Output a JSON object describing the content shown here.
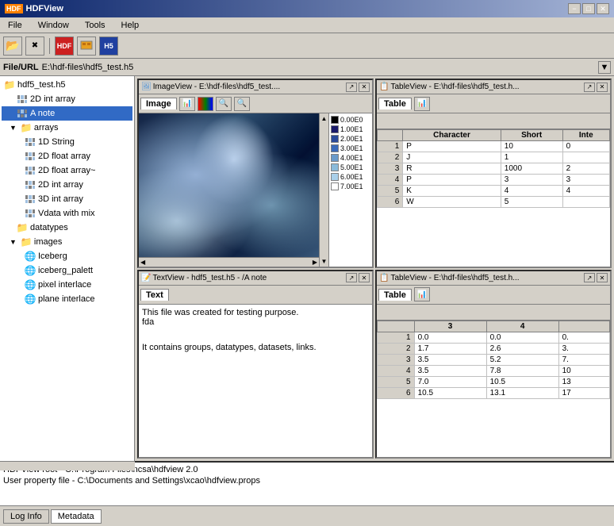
{
  "app": {
    "title": "HDFView",
    "title_icon": "HDF"
  },
  "title_bar": {
    "title": "HDFView",
    "min_label": "−",
    "max_label": "□",
    "close_label": "✕"
  },
  "menu_bar": {
    "items": [
      {
        "label": "File",
        "id": "file"
      },
      {
        "label": "Window",
        "id": "window"
      },
      {
        "label": "Tools",
        "id": "tools"
      },
      {
        "label": "Help",
        "id": "help"
      }
    ]
  },
  "toolbar": {
    "buttons": [
      {
        "id": "open",
        "icon": "📂",
        "label": "Open"
      },
      {
        "id": "close",
        "icon": "❌",
        "label": "Close"
      },
      {
        "id": "btn3",
        "icon": "🔴",
        "label": "Button3"
      },
      {
        "id": "btn4",
        "icon": "📋",
        "label": "Button4"
      },
      {
        "id": "btn5",
        "icon": "📊",
        "label": "Button5"
      }
    ]
  },
  "file_url": {
    "label": "File/URL",
    "value": "E:\\hdf-files\\hdf5_test.h5"
  },
  "tree": {
    "items": [
      {
        "id": "root",
        "label": "hdf5_test.h5",
        "type": "file",
        "level": 0,
        "expanded": true
      },
      {
        "id": "2d_int_array",
        "label": "2D int array",
        "type": "dataset",
        "level": 1
      },
      {
        "id": "a_note",
        "label": "A note",
        "type": "dataset",
        "level": 1,
        "selected": true
      },
      {
        "id": "arrays",
        "label": "arrays",
        "type": "group",
        "level": 1,
        "expanded": true
      },
      {
        "id": "1d_string",
        "label": "1D String",
        "type": "dataset",
        "level": 2
      },
      {
        "id": "2d_float_array",
        "label": "2D float array",
        "type": "dataset",
        "level": 2
      },
      {
        "id": "2d_float_array2",
        "label": "2D float array~",
        "type": "dataset",
        "level": 2
      },
      {
        "id": "2d_int_array2",
        "label": "2D int array",
        "type": "dataset",
        "level": 2
      },
      {
        "id": "3d_int_array",
        "label": "3D int array",
        "type": "dataset",
        "level": 2
      },
      {
        "id": "vdata",
        "label": "Vdata with mix",
        "type": "dataset",
        "level": 2
      },
      {
        "id": "datatypes",
        "label": "datatypes",
        "type": "group",
        "level": 1
      },
      {
        "id": "images",
        "label": "images",
        "type": "group",
        "level": 1,
        "expanded": true
      },
      {
        "id": "iceberg",
        "label": "Iceberg",
        "type": "image",
        "level": 2
      },
      {
        "id": "iceberg_palette",
        "label": "iceberg_palett",
        "type": "image",
        "level": 2
      },
      {
        "id": "pixel_interlace",
        "label": "pixel interlace",
        "type": "image",
        "level": 2
      },
      {
        "id": "plane_interlace",
        "label": "plane interlace",
        "type": "image",
        "level": 2
      }
    ]
  },
  "panels": {
    "image_view": {
      "title": "ImageView - E:\\hdf-files\\hdf5_test....",
      "tab": "Image",
      "colorbar": [
        {
          "label": "0.00E0",
          "color": "#000000"
        },
        {
          "label": "1.00E1",
          "color": "#1a1a6a"
        },
        {
          "label": "2.00E1",
          "color": "#2a4a9a"
        },
        {
          "label": "3.00E1",
          "color": "#3a6aba"
        },
        {
          "label": "4.00E1",
          "color": "#6a9aca"
        },
        {
          "label": "5.00E1",
          "color": "#8abada"
        },
        {
          "label": "6.00E1",
          "color": "#aad0ea"
        },
        {
          "label": "7.00E1",
          "color": "#ffffff"
        }
      ]
    },
    "table_view_1": {
      "title": "TableView - E:\\hdf-files\\hdf5_test.h...",
      "tab": "Table",
      "columns": [
        "Character",
        "Short",
        "Inte"
      ],
      "rows": [
        {
          "idx": "1",
          "c0": "P",
          "c1": "10",
          "c2": "0"
        },
        {
          "idx": "2",
          "c0": "J",
          "c1": "1",
          "c2": ""
        },
        {
          "idx": "3",
          "c0": "R",
          "c1": "1000",
          "c2": "2"
        },
        {
          "idx": "4",
          "c0": "P",
          "c1": "3",
          "c2": "3"
        },
        {
          "idx": "5",
          "c0": "K",
          "c1": "4",
          "c2": "4"
        },
        {
          "idx": "6",
          "c0": "W",
          "c1": "5",
          "c2": ""
        }
      ]
    },
    "text_view": {
      "title": "TextView - hdf5_test.h5 - /A note",
      "tab": "Text",
      "lines": [
        "This file was created for testing purpose.",
        "fda",
        "",
        "It contains groups, datatypes, datasets, links."
      ]
    },
    "table_view_2": {
      "title": "TableView - E:\\hdf-files\\hdf5_test.h...",
      "tab": "Table",
      "columns": [
        "3",
        "4"
      ],
      "rows": [
        {
          "idx": "1",
          "c0": "0.0",
          "c1": "0.0",
          "c2": "0."
        },
        {
          "idx": "2",
          "c0": "1.7",
          "c1": "2.6",
          "c2": "3."
        },
        {
          "idx": "3",
          "c0": "3.5",
          "c1": "5.2",
          "c2": "7."
        },
        {
          "idx": "4",
          "c0": "3.5",
          "c1": "7.8",
          "c2": "10"
        },
        {
          "idx": "5",
          "c0": "7.0",
          "c1": "10.5",
          "c2": "13"
        },
        {
          "idx": "6",
          "c0": "10.5",
          "c1": "13.1",
          "c2": "17"
        }
      ]
    }
  },
  "status_bar": {
    "line1": "HDFView root - C:\\Program Files\\ncsa\\hdfview 2.0",
    "line2": "User property file - C:\\Documents and Settings\\xcao\\hdfview.props"
  },
  "bottom_tabs": [
    {
      "label": "Log Info",
      "id": "log",
      "active": false
    },
    {
      "label": "Metadata",
      "id": "metadata",
      "active": true
    }
  ]
}
